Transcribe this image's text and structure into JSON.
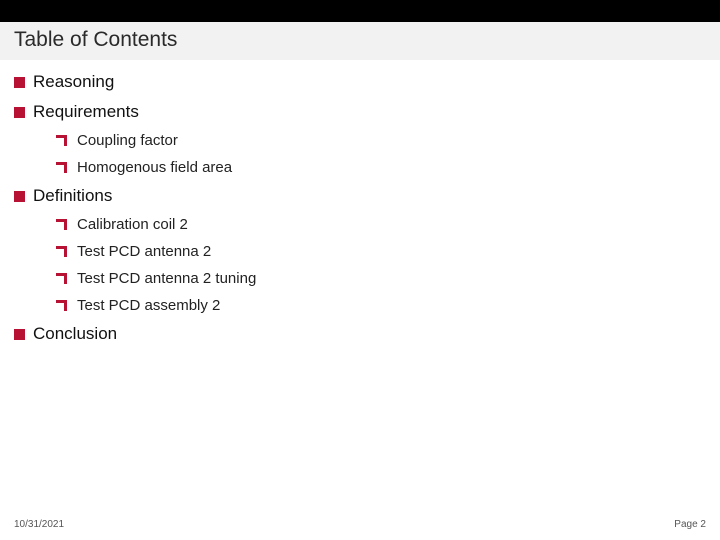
{
  "title": "Table of Contents",
  "items": [
    {
      "label": "Reasoning",
      "children": []
    },
    {
      "label": "Requirements",
      "children": [
        {
          "label": "Coupling factor"
        },
        {
          "label": "Homogenous field area"
        }
      ]
    },
    {
      "label": "Definitions",
      "children": [
        {
          "label": "Calibration coil 2"
        },
        {
          "label": "Test PCD antenna 2"
        },
        {
          "label": "Test PCD antenna 2 tuning"
        },
        {
          "label": "Test PCD assembly 2"
        }
      ]
    },
    {
      "label": "Conclusion",
      "children": []
    }
  ],
  "footer": {
    "date": "10/31/2021",
    "page": "Page 2"
  },
  "colors": {
    "accent": "#b71234",
    "band": "#f2f2f2",
    "topbar": "#000000"
  }
}
